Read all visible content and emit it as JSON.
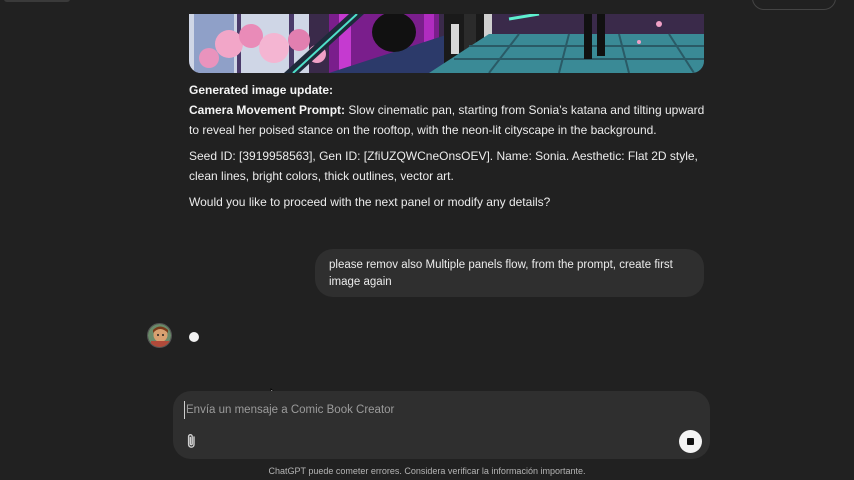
{
  "conversation": {
    "generated_image": {
      "alt": "Sonia on a neon rooftop with cherry blossoms"
    },
    "assistant_message": {
      "heading": "Generated image update:",
      "camera_label": "Camera Movement Prompt:",
      "camera_text": " Slow cinematic pan, starting from Sonia’s katana and tilting upward to reveal her poised stance on the rooftop, with the neon-lit cityscape in the background.",
      "seed_text": "Seed ID: [3919958563], Gen ID: [ZfiUZQWCneOnsOEV]. Name: Sonia. Aesthetic: Flat 2D style, clean lines, bright colors, thick outlines, vector art.",
      "question": "Would you like to proceed with the next panel or modify any details?"
    },
    "user_message": {
      "text": "please remov also Multiple panels flow, from the prompt, create first image again"
    }
  },
  "composer": {
    "placeholder": "Envía un mensaje a Comic Book Creator",
    "attach_icon": "paperclip-icon",
    "stop_icon": "stop-icon"
  },
  "footer": {
    "disclaimer": "ChatGPT puede cometer errores. Considera verificar la información importante."
  },
  "colors": {
    "background": "#212121",
    "bubble": "#2f2f2f",
    "text": "#ececec"
  }
}
